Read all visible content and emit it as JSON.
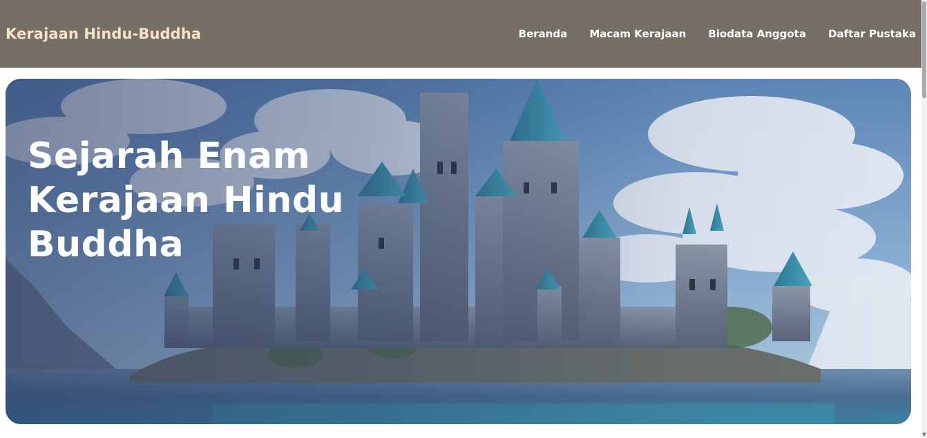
{
  "header": {
    "brand": "Kerajaan Hindu-Buddha",
    "nav": [
      {
        "label": "Beranda"
      },
      {
        "label": "Macam Kerajaan"
      },
      {
        "label": "Biodata Anggota"
      },
      {
        "label": "Daftar Pustaka"
      }
    ]
  },
  "hero": {
    "title": "Sejarah Enam Kerajaan Hindu Buddha",
    "image": "fantasy-castle-on-lake"
  },
  "colors": {
    "navbar_bg": "#756f65",
    "brand_text": "#f6e3c8",
    "nav_text": "#ffffff",
    "castle_roof": "#3a8fa8"
  }
}
